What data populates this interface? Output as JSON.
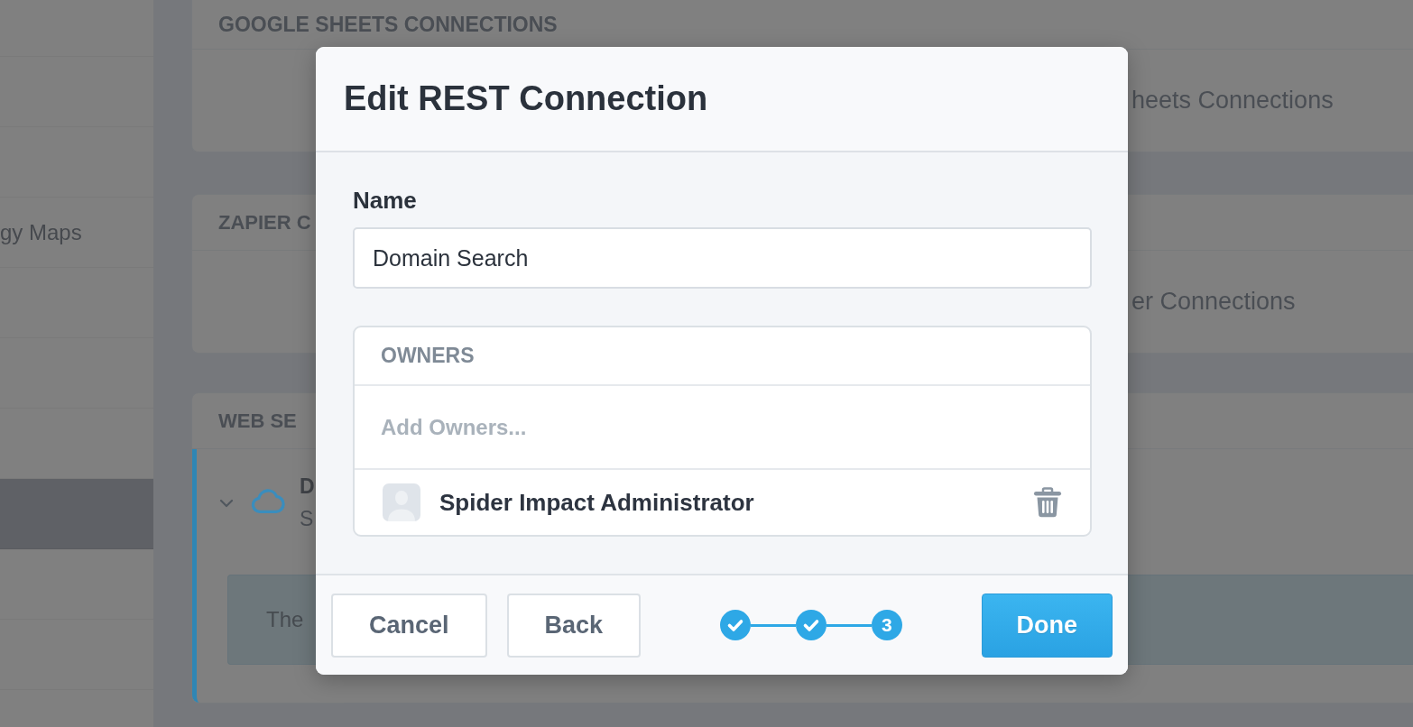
{
  "sidebar": {
    "items": [
      {
        "selected": false
      },
      {
        "selected": false
      },
      {
        "selected": false
      },
      {
        "label": "gy Maps",
        "selected": false
      },
      {
        "selected": false
      },
      {
        "selected": false
      },
      {
        "selected": false
      },
      {
        "selected": true
      },
      {
        "selected": false
      },
      {
        "selected": false
      }
    ]
  },
  "cards": [
    {
      "title": "GOOGLE SHEETS CONNECTIONS",
      "link": "heets Connections"
    },
    {
      "title": "ZAPIER C",
      "link": "er Connections"
    },
    {
      "title": "WEB SE",
      "connections": [
        {
          "name": "D",
          "detail": "S",
          "selected": true,
          "expanded": true,
          "message": "The"
        }
      ]
    }
  ],
  "dialog": {
    "title": "Edit REST Connection",
    "name_field": {
      "label": "Name",
      "value": "Domain Search"
    },
    "owners": {
      "title": "OWNERS",
      "search": {
        "placeholder": "Add Owners..."
      },
      "items": [
        {
          "name": "Spider Impact Administrator"
        }
      ]
    },
    "footer": {
      "buttons": [
        "Cancel",
        "Back"
      ],
      "stepper": {
        "steps": [
          {
            "completed": true
          },
          {
            "completed": true
          },
          {
            "completed": false,
            "label": "3"
          }
        ]
      },
      "done_button": "Done"
    }
  }
}
